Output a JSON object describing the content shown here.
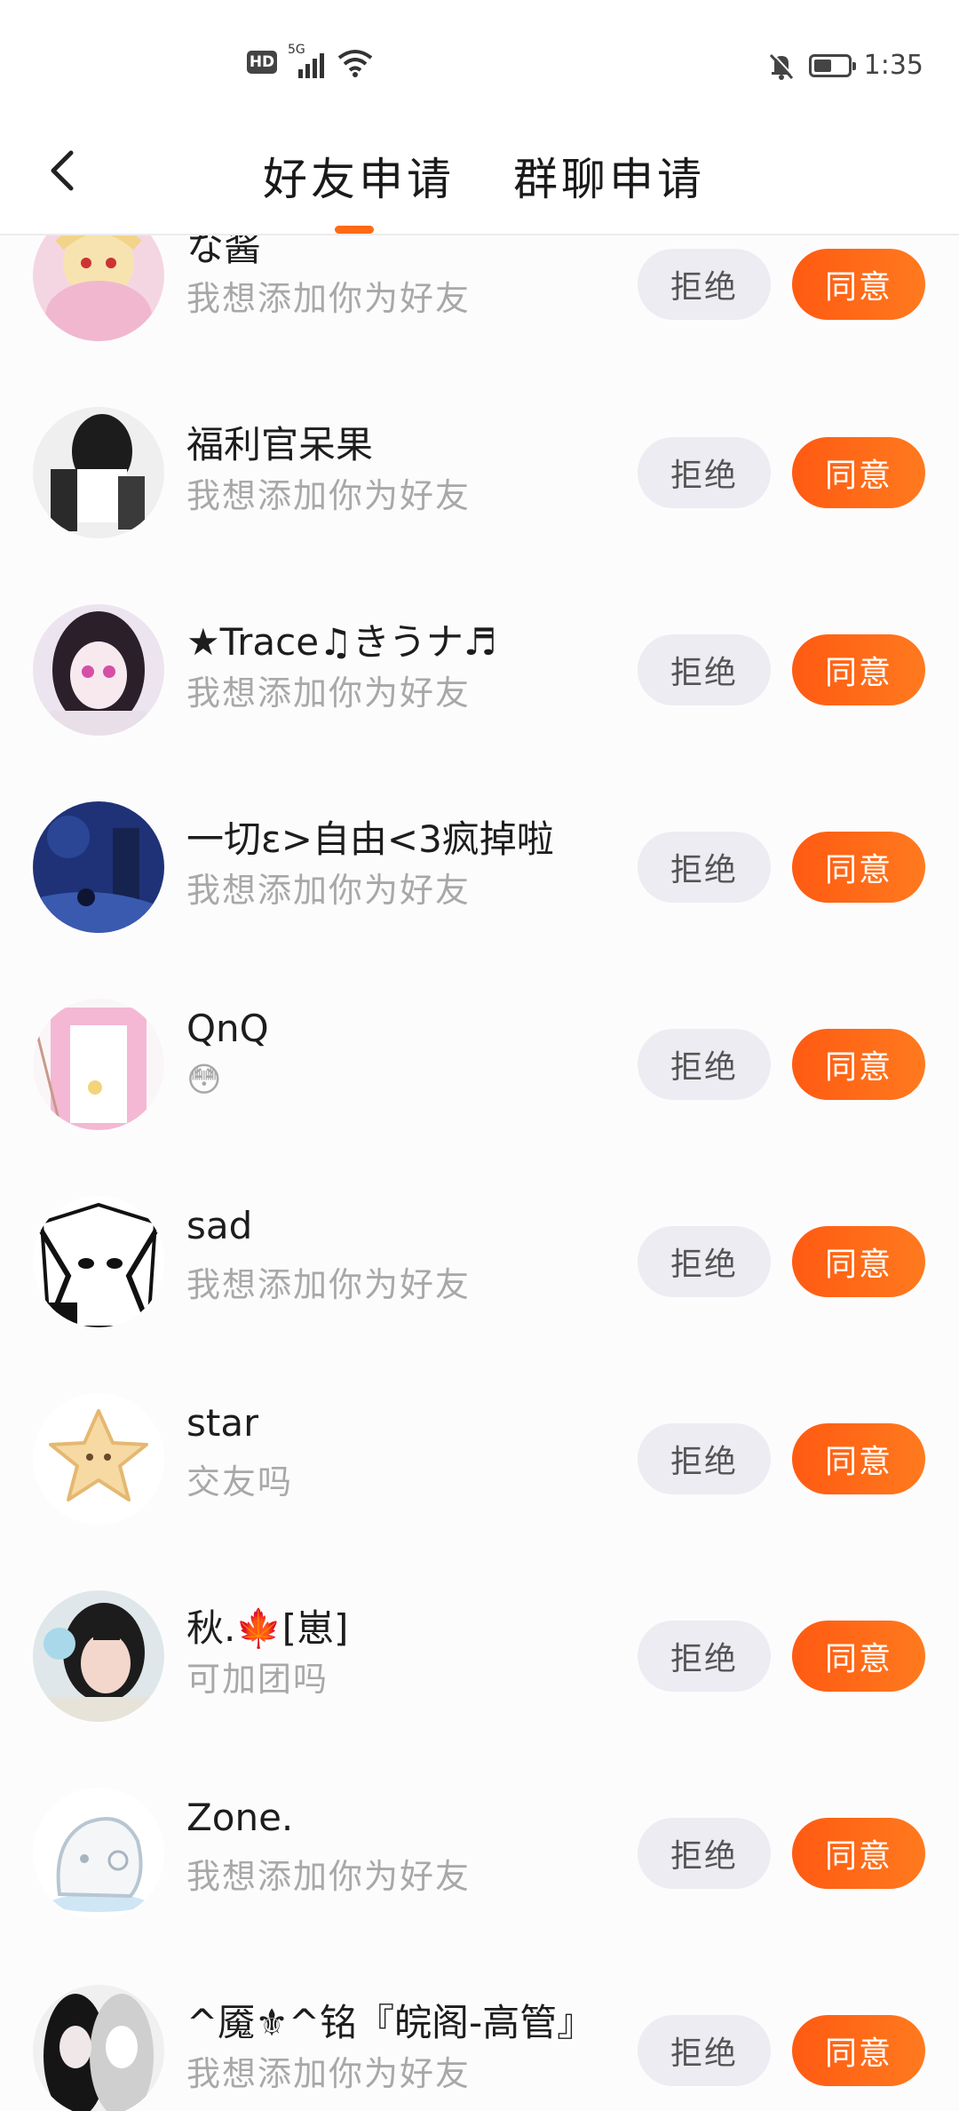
{
  "status_bar": {
    "network_badge": "HD",
    "network_type": "5G",
    "time": "1:35",
    "icons": [
      "hd-icon",
      "signal-icon",
      "wifi-icon",
      "mute-bell-icon",
      "battery-icon"
    ],
    "battery_level": 0.45
  },
  "header": {
    "back_icon": "chevron-left-icon",
    "tabs": [
      {
        "label": "好友申请",
        "active": true
      },
      {
        "label": "群聊申请",
        "active": false
      }
    ],
    "accent_color": "#ff6a16"
  },
  "requests": [
    {
      "name": "な酱",
      "message": "我想添加你为好友"
    },
    {
      "name": "福利官呆果",
      "message": "我想添加你为好友"
    },
    {
      "name": "★Trace♫きうナ♬",
      "message": "我想添加你为好友"
    },
    {
      "name": "一切ε>自由<3疯掉啦",
      "message": "我想添加你为好友"
    },
    {
      "name": "QnQ",
      "message": "😳"
    },
    {
      "name": "sad",
      "message": "我想添加你为好友"
    },
    {
      "name": "star",
      "message": "交友吗"
    },
    {
      "name": "秋.🍁[崽]",
      "message": "可加团吗"
    },
    {
      "name": "Zone.",
      "message": "我想添加你为好友"
    },
    {
      "name": "^魇⚜^铭『皖阁-高管』",
      "message": "我想添加你为好友"
    }
  ],
  "actions": {
    "reject_label": "拒绝",
    "accept_label": "同意",
    "reject_color": "#ececf2",
    "accept_color": "#ff6a16"
  }
}
